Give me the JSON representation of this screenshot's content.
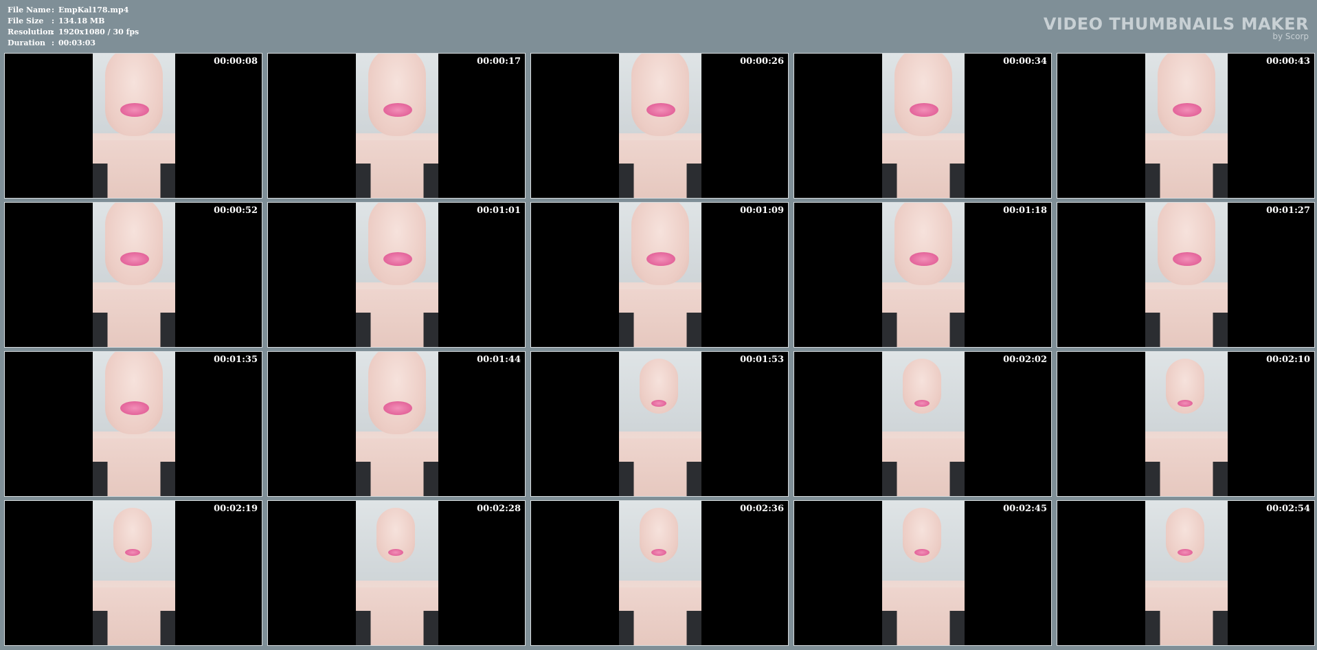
{
  "info": {
    "file_name_label": "File Name",
    "file_name_value": "EmpKal178.mp4",
    "file_size_label": "File Size",
    "file_size_value": "134.18 MB",
    "resolution_label": "Resolution",
    "resolution_value": "1920x1080 / 30 fps",
    "duration_label": "Duration",
    "duration_value": "00:03:03",
    "separator": ":"
  },
  "brand": {
    "title": "VIDEO THUMBNAILS MAKER",
    "subtitle": "by Scorp"
  },
  "thumbnails": [
    {
      "timestamp": "00:00:08"
    },
    {
      "timestamp": "00:00:17"
    },
    {
      "timestamp": "00:00:26"
    },
    {
      "timestamp": "00:00:34"
    },
    {
      "timestamp": "00:00:43"
    },
    {
      "timestamp": "00:00:52"
    },
    {
      "timestamp": "00:01:01"
    },
    {
      "timestamp": "00:01:09"
    },
    {
      "timestamp": "00:01:18"
    },
    {
      "timestamp": "00:01:27"
    },
    {
      "timestamp": "00:01:35"
    },
    {
      "timestamp": "00:01:44"
    },
    {
      "timestamp": "00:01:53"
    },
    {
      "timestamp": "00:02:02"
    },
    {
      "timestamp": "00:02:10"
    },
    {
      "timestamp": "00:02:19"
    },
    {
      "timestamp": "00:02:28"
    },
    {
      "timestamp": "00:02:36"
    },
    {
      "timestamp": "00:02:45"
    },
    {
      "timestamp": "00:02:54"
    }
  ]
}
